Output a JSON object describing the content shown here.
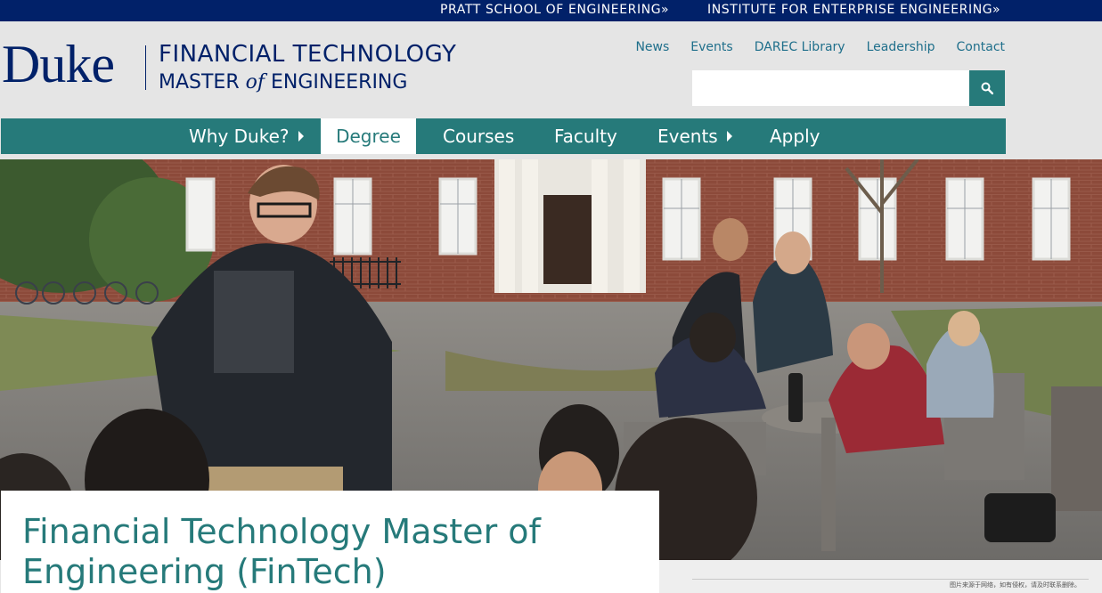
{
  "top_links": {
    "pratt": "PRATT SCHOOL OF ENGINEERING»",
    "institute": "INSTITUTE FOR ENTERPRISE ENGINEERING»"
  },
  "logo": {
    "duke": "Duke",
    "line1": "FINANCIAL TECHNOLOGY",
    "line2_a": "MASTER ",
    "line2_of": "of",
    "line2_b": " ENGINEERING"
  },
  "utility_nav": [
    "News",
    "Events",
    "DAREC Library",
    "Leadership",
    "Contact"
  ],
  "search": {
    "placeholder": "",
    "icon": "search-icon"
  },
  "main_nav": {
    "why_duke": "Why Duke?",
    "degree": "Degree",
    "courses": "Courses",
    "faculty": "Faculty",
    "events": "Events",
    "apply": "Apply",
    "active": "Degree"
  },
  "hero_title": "Financial Technology Master of Engineering (FinTech)",
  "image_note": "图片来源于网络，如有侵权，请及时联系删除。",
  "colors": {
    "duke_navy": "#012169",
    "teal": "#267a7a",
    "link_blue": "#1f6f8b"
  }
}
